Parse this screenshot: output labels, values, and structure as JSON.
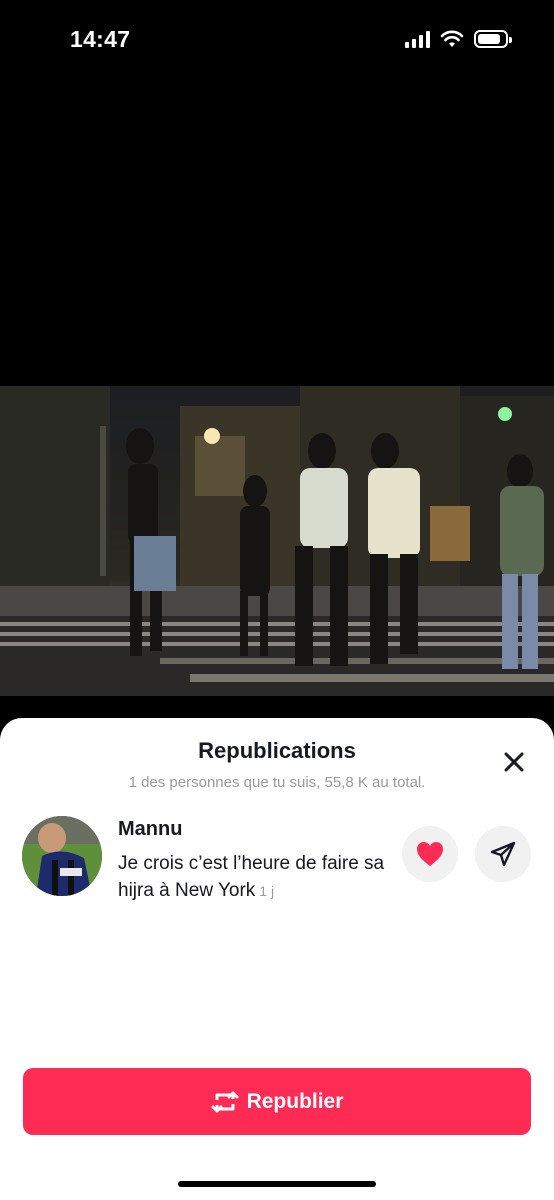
{
  "status_bar": {
    "time": "14:47",
    "icons": [
      "signal-icon",
      "wifi-icon",
      "battery-icon"
    ]
  },
  "video": {
    "description_icon": "video-frame"
  },
  "sheet": {
    "title": "Republications",
    "subtitle": "1 des personnes que tu suis, 55,8 K au total.",
    "close_icon": "close-icon",
    "repost": {
      "user_name": "Mannu",
      "comment": "Je crois c’est l’heure de faire sa hijra à New York",
      "time": "1 j",
      "like_icon": "heart-icon",
      "send_icon": "send-icon"
    },
    "republish_button": {
      "label": "Republier",
      "icon": "repost-icon"
    }
  },
  "colors": {
    "accent": "#fe2c55",
    "like": "#fe2c55",
    "secondary_text": "#9a9a9e",
    "primary_text": "#161823"
  }
}
